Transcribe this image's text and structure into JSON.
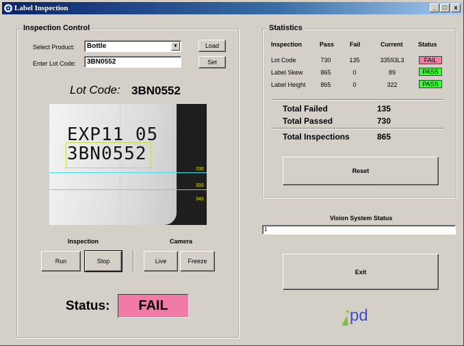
{
  "window": {
    "title": "Label Inspection",
    "minimize": "_",
    "maximize": "□",
    "close": "x"
  },
  "inspection_control": {
    "group_label": "Inspection Control",
    "select_product_label": "Select Product:",
    "product_value": "Bottle",
    "lot_code_label": "Enter Lot Code:",
    "lot_code_value": "3BN0552",
    "load_label": "Load",
    "set_label": "Set",
    "lot_display_label": "Lot Code:",
    "lot_display_value": "3BN0552",
    "image": {
      "line1": "EXP11  05",
      "line2": "3BN0552",
      "meas": [
        "230",
        "333",
        "343"
      ]
    },
    "inspection_label": "Inspection",
    "camera_label": "Camera",
    "run_label": "Run",
    "stop_label": "Stop",
    "live_label": "Live",
    "freeze_label": "Freeze",
    "status_label": "Status:",
    "status_value": "FAIL"
  },
  "statistics": {
    "group_label": "Statistics",
    "headers": [
      "Inspection",
      "Pass",
      "Fail",
      "Current",
      "Status"
    ],
    "rows": [
      {
        "name": "Lot Code",
        "pass": "730",
        "fail": "135",
        "current": "33593L3",
        "status": "FAIL"
      },
      {
        "name": "Label Skew",
        "pass": "865",
        "fail": "0",
        "current": "89",
        "status": "PASS"
      },
      {
        "name": "Label Height",
        "pass": "865",
        "fail": "0",
        "current": "322",
        "status": "PASS"
      }
    ],
    "total_failed_label": "Total Failed",
    "total_failed": "135",
    "total_passed_label": "Total Passed",
    "total_passed": "730",
    "total_inspections_label": "Total Inspections",
    "total_inspections": "865",
    "reset_label": "Reset"
  },
  "vision": {
    "label": "Vision System Status",
    "value": "1"
  },
  "exit_label": "Exit",
  "logo": {
    "text": "pd"
  },
  "colors": {
    "fail": "#f27aa6",
    "pass": "#33ff33",
    "title_bar": "#0a246a",
    "logo": "#7fbf3f"
  }
}
